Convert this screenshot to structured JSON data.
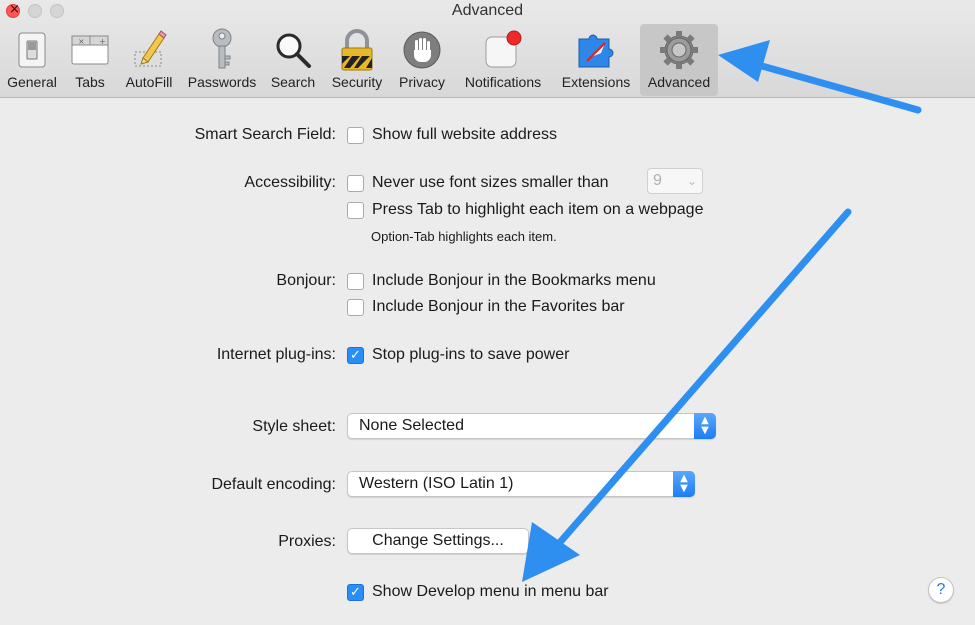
{
  "window": {
    "title": "Advanced"
  },
  "toolbar": {
    "tabs": [
      {
        "label": "General",
        "icon": "general-switch-icon"
      },
      {
        "label": "Tabs",
        "icon": "tabs-icon"
      },
      {
        "label": "AutoFill",
        "icon": "pencil-icon"
      },
      {
        "label": "Passwords",
        "icon": "key-icon"
      },
      {
        "label": "Search",
        "icon": "magnifier-icon"
      },
      {
        "label": "Security",
        "icon": "padlock-icon"
      },
      {
        "label": "Privacy",
        "icon": "hand-icon"
      },
      {
        "label": "Notifications",
        "icon": "notification-badge-icon"
      },
      {
        "label": "Extensions",
        "icon": "puzzle-compass-icon"
      },
      {
        "label": "Advanced",
        "icon": "gear-icon",
        "selected": true
      }
    ]
  },
  "settings": {
    "smart_search": {
      "label": "Smart Search Field:",
      "option": "Show full website address",
      "checked": false
    },
    "accessibility": {
      "label": "Accessibility:",
      "font_option": "Never use font sizes smaller than",
      "font_option_checked": false,
      "font_size_value": "9",
      "tab_option": "Press Tab to highlight each item on a webpage",
      "tab_option_checked": false,
      "note": "Option-Tab highlights each item."
    },
    "bonjour": {
      "label": "Bonjour:",
      "bookmarks_option": "Include Bonjour in the Bookmarks menu",
      "bookmarks_checked": false,
      "favorites_option": "Include Bonjour in the Favorites bar",
      "favorites_checked": false
    },
    "plugins": {
      "label": "Internet plug-ins:",
      "option": "Stop plug-ins to save power",
      "checked": true
    },
    "style_sheet": {
      "label": "Style sheet:",
      "value": "None Selected"
    },
    "encoding": {
      "label": "Default encoding:",
      "value": "Western (ISO Latin 1)"
    },
    "proxies": {
      "label": "Proxies:",
      "button": "Change Settings..."
    },
    "develop": {
      "option": "Show Develop menu in menu bar",
      "checked": true
    },
    "help": "?"
  },
  "colors": {
    "accent": "#2a8ef7",
    "annotation_arrow": "#2e8ff0"
  }
}
